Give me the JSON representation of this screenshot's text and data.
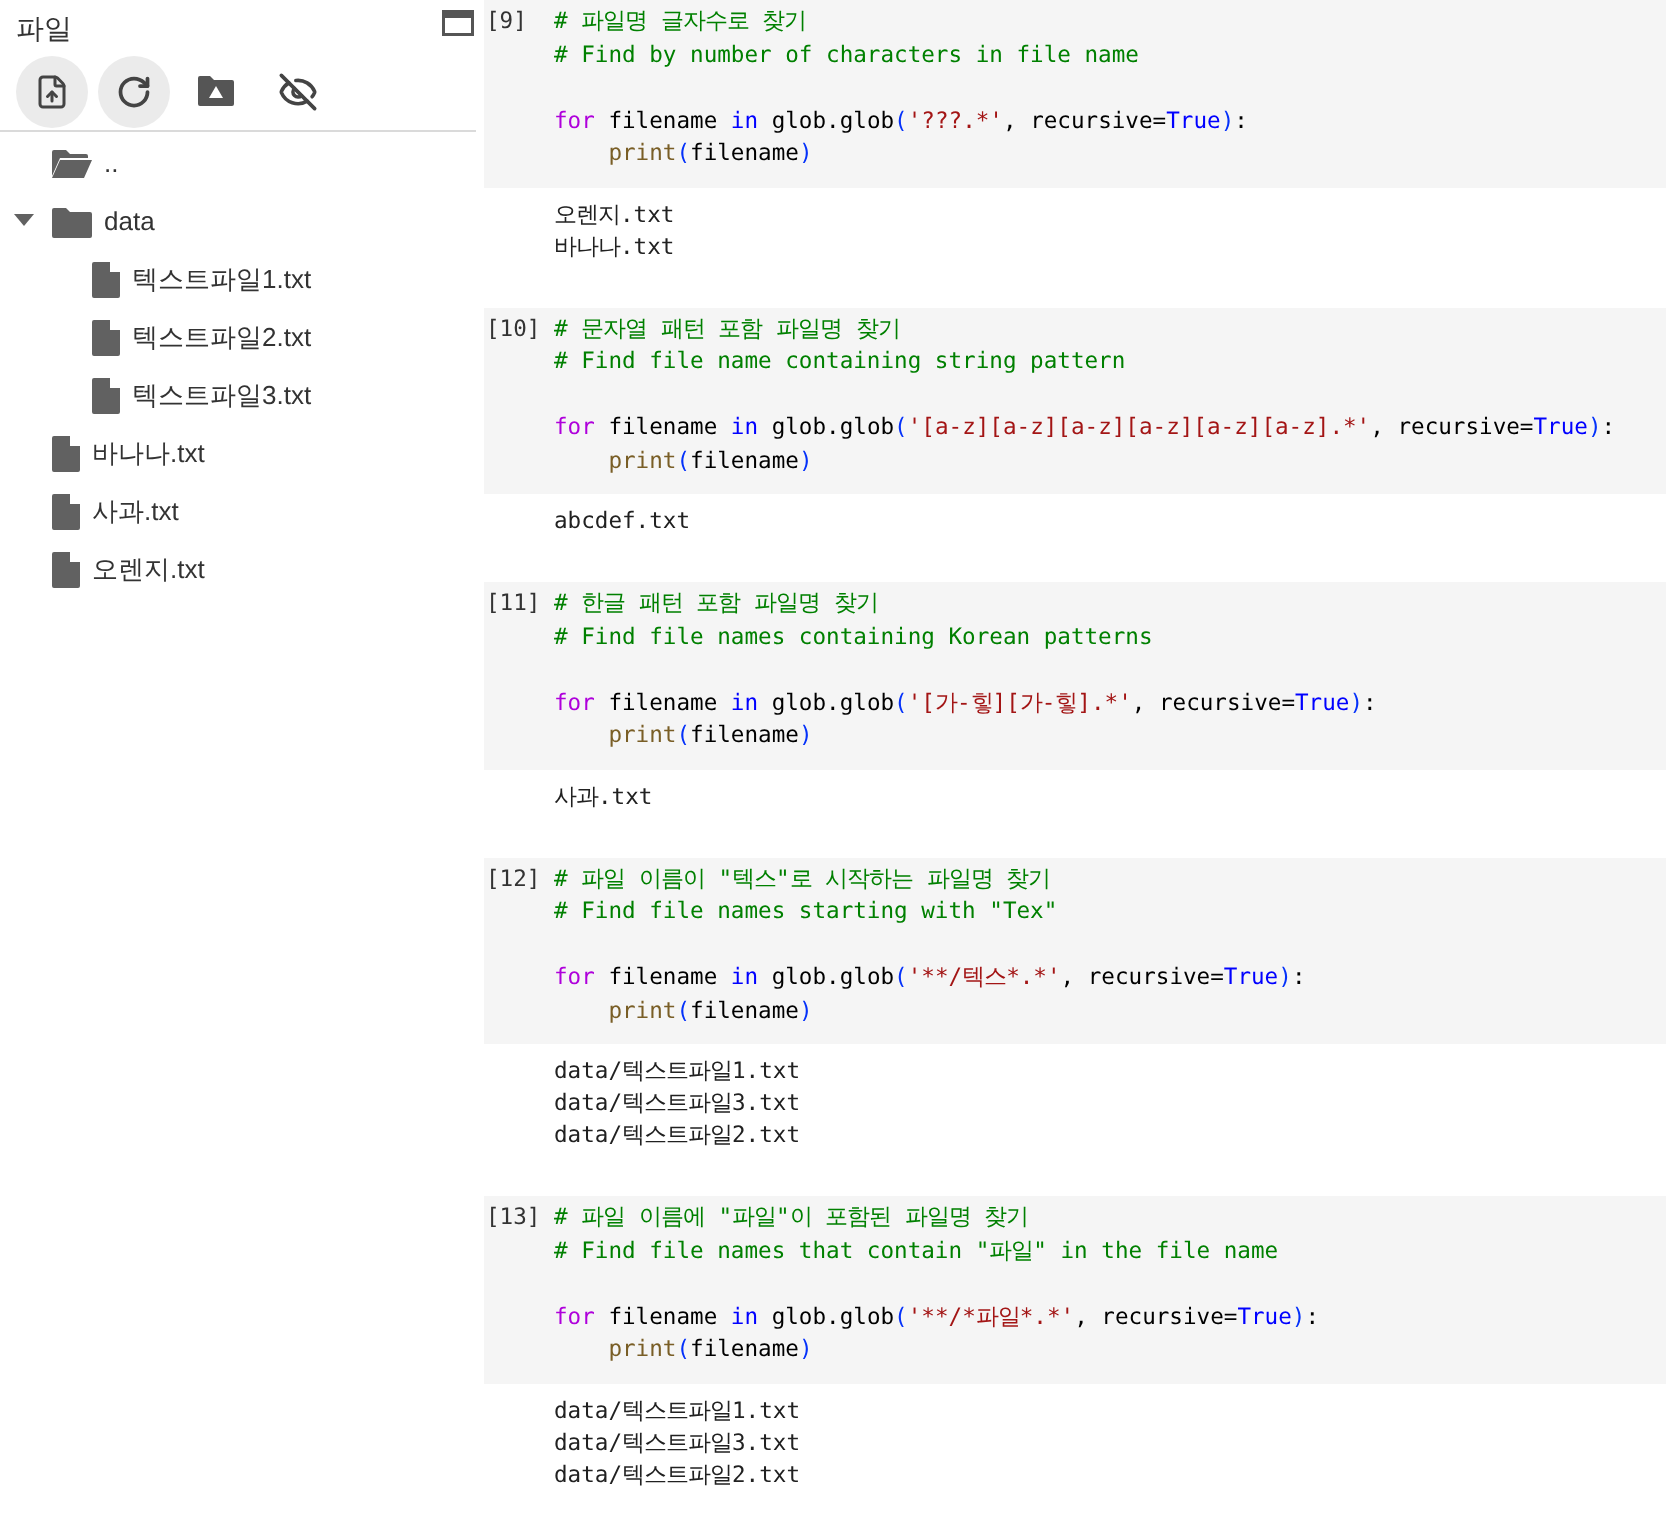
{
  "sidebar": {
    "title": "파일",
    "toolbar": [
      {
        "kind": "upload",
        "highlighted": true
      },
      {
        "kind": "refresh",
        "highlighted": true
      },
      {
        "kind": "drive",
        "highlighted": false
      },
      {
        "kind": "hide",
        "highlighted": false
      }
    ],
    "tree": [
      {
        "kind": "parent",
        "label": ".."
      },
      {
        "kind": "folder",
        "label": "data",
        "expanded": true,
        "children": [
          {
            "kind": "file",
            "label": "텍스트파일1.txt"
          },
          {
            "kind": "file",
            "label": "텍스트파일2.txt"
          },
          {
            "kind": "file",
            "label": "텍스트파일3.txt"
          }
        ]
      },
      {
        "kind": "file",
        "label": "바나나.txt"
      },
      {
        "kind": "file",
        "label": "사과.txt"
      },
      {
        "kind": "file",
        "label": "오렌지.txt"
      }
    ]
  },
  "cells": [
    {
      "number": "[9]",
      "comments": [
        "# 파일명 글자수로 찾기",
        "# Find by number of characters in file name"
      ],
      "code": [
        {
          "indented": false,
          "tokens": [
            {
              "kind": "keyword",
              "text": "for"
            },
            {
              "kind": "plain",
              "text": " filename "
            },
            {
              "kind": "operator",
              "text": "in"
            },
            {
              "kind": "plain",
              "text": " glob.glob"
            },
            {
              "kind": "bracket",
              "text": "("
            },
            {
              "kind": "string",
              "text": "'???.*'"
            },
            {
              "kind": "plain",
              "text": ", recursive="
            },
            {
              "kind": "operator",
              "text": "True"
            },
            {
              "kind": "bracket",
              "text": ")"
            },
            {
              "kind": "plain",
              "text": ":"
            }
          ]
        },
        {
          "indented": true,
          "tokens": [
            {
              "kind": "function",
              "text": "print"
            },
            {
              "kind": "bracket",
              "text": "("
            },
            {
              "kind": "plain",
              "text": "filename"
            },
            {
              "kind": "bracket",
              "text": ")"
            }
          ]
        }
      ],
      "output": [
        "오렌지.txt",
        "바나나.txt"
      ]
    },
    {
      "number": "[10]",
      "comments": [
        "# 문자열 패턴 포함 파일명 찾기",
        "# Find file name containing string pattern"
      ],
      "code": [
        {
          "indented": false,
          "tokens": [
            {
              "kind": "keyword",
              "text": "for"
            },
            {
              "kind": "plain",
              "text": " filename "
            },
            {
              "kind": "operator",
              "text": "in"
            },
            {
              "kind": "plain",
              "text": " glob.glob"
            },
            {
              "kind": "bracket",
              "text": "("
            },
            {
              "kind": "string",
              "text": "'[a-z][a-z][a-z][a-z][a-z][a-z].*'"
            },
            {
              "kind": "plain",
              "text": ", recursive="
            },
            {
              "kind": "operator",
              "text": "True"
            },
            {
              "kind": "bracket",
              "text": ")"
            },
            {
              "kind": "plain",
              "text": ":"
            }
          ]
        },
        {
          "indented": true,
          "tokens": [
            {
              "kind": "function",
              "text": "print"
            },
            {
              "kind": "bracket",
              "text": "("
            },
            {
              "kind": "plain",
              "text": "filename"
            },
            {
              "kind": "bracket",
              "text": ")"
            }
          ]
        }
      ],
      "output": [
        "abcdef.txt"
      ]
    },
    {
      "number": "[11]",
      "comments": [
        "# 한글 패턴 포함 파일명 찾기",
        "# Find file names containing Korean patterns"
      ],
      "code": [
        {
          "indented": false,
          "tokens": [
            {
              "kind": "keyword",
              "text": "for"
            },
            {
              "kind": "plain",
              "text": " filename "
            },
            {
              "kind": "operator",
              "text": "in"
            },
            {
              "kind": "plain",
              "text": " glob.glob"
            },
            {
              "kind": "bracket",
              "text": "("
            },
            {
              "kind": "string",
              "text": "'[가-힣][가-힣].*'"
            },
            {
              "kind": "plain",
              "text": ", recursive="
            },
            {
              "kind": "operator",
              "text": "True"
            },
            {
              "kind": "bracket",
              "text": ")"
            },
            {
              "kind": "plain",
              "text": ":"
            }
          ]
        },
        {
          "indented": true,
          "tokens": [
            {
              "kind": "function",
              "text": "print"
            },
            {
              "kind": "bracket",
              "text": "("
            },
            {
              "kind": "plain",
              "text": "filename"
            },
            {
              "kind": "bracket",
              "text": ")"
            }
          ]
        }
      ],
      "output": [
        "사과.txt"
      ]
    },
    {
      "number": "[12]",
      "comments": [
        "# 파일 이름이 \"텍스\"로 시작하는 파일명 찾기",
        "# Find file names starting with \"Tex\""
      ],
      "code": [
        {
          "indented": false,
          "tokens": [
            {
              "kind": "keyword",
              "text": "for"
            },
            {
              "kind": "plain",
              "text": " filename "
            },
            {
              "kind": "operator",
              "text": "in"
            },
            {
              "kind": "plain",
              "text": " glob.glob"
            },
            {
              "kind": "bracket",
              "text": "("
            },
            {
              "kind": "string",
              "text": "'**/텍스*.*'"
            },
            {
              "kind": "plain",
              "text": ", recursive="
            },
            {
              "kind": "operator",
              "text": "True"
            },
            {
              "kind": "bracket",
              "text": ")"
            },
            {
              "kind": "plain",
              "text": ":"
            }
          ]
        },
        {
          "indented": true,
          "tokens": [
            {
              "kind": "function",
              "text": "print"
            },
            {
              "kind": "bracket",
              "text": "("
            },
            {
              "kind": "plain",
              "text": "filename"
            },
            {
              "kind": "bracket",
              "text": ")"
            }
          ]
        }
      ],
      "output": [
        "data/텍스트파일1.txt",
        "data/텍스트파일3.txt",
        "data/텍스트파일2.txt"
      ]
    },
    {
      "number": "[13]",
      "comments": [
        "# 파일 이름에 \"파일\"이 포함된 파일명 찾기",
        "# Find file names that contain \"파일\" in the file name"
      ],
      "code": [
        {
          "indented": false,
          "tokens": [
            {
              "kind": "keyword",
              "text": "for"
            },
            {
              "kind": "plain",
              "text": " filename "
            },
            {
              "kind": "operator",
              "text": "in"
            },
            {
              "kind": "plain",
              "text": " glob.glob"
            },
            {
              "kind": "bracket",
              "text": "("
            },
            {
              "kind": "string",
              "text": "'**/*파일*.*'"
            },
            {
              "kind": "plain",
              "text": ", recursive="
            },
            {
              "kind": "operator",
              "text": "True"
            },
            {
              "kind": "bracket",
              "text": ")"
            },
            {
              "kind": "plain",
              "text": ":"
            }
          ]
        },
        {
          "indented": true,
          "tokens": [
            {
              "kind": "function",
              "text": "print"
            },
            {
              "kind": "bracket",
              "text": "("
            },
            {
              "kind": "plain",
              "text": "filename"
            },
            {
              "kind": "bracket",
              "text": ")"
            }
          ]
        }
      ],
      "output": [
        "data/텍스트파일1.txt",
        "data/텍스트파일3.txt",
        "data/텍스트파일2.txt"
      ]
    }
  ]
}
